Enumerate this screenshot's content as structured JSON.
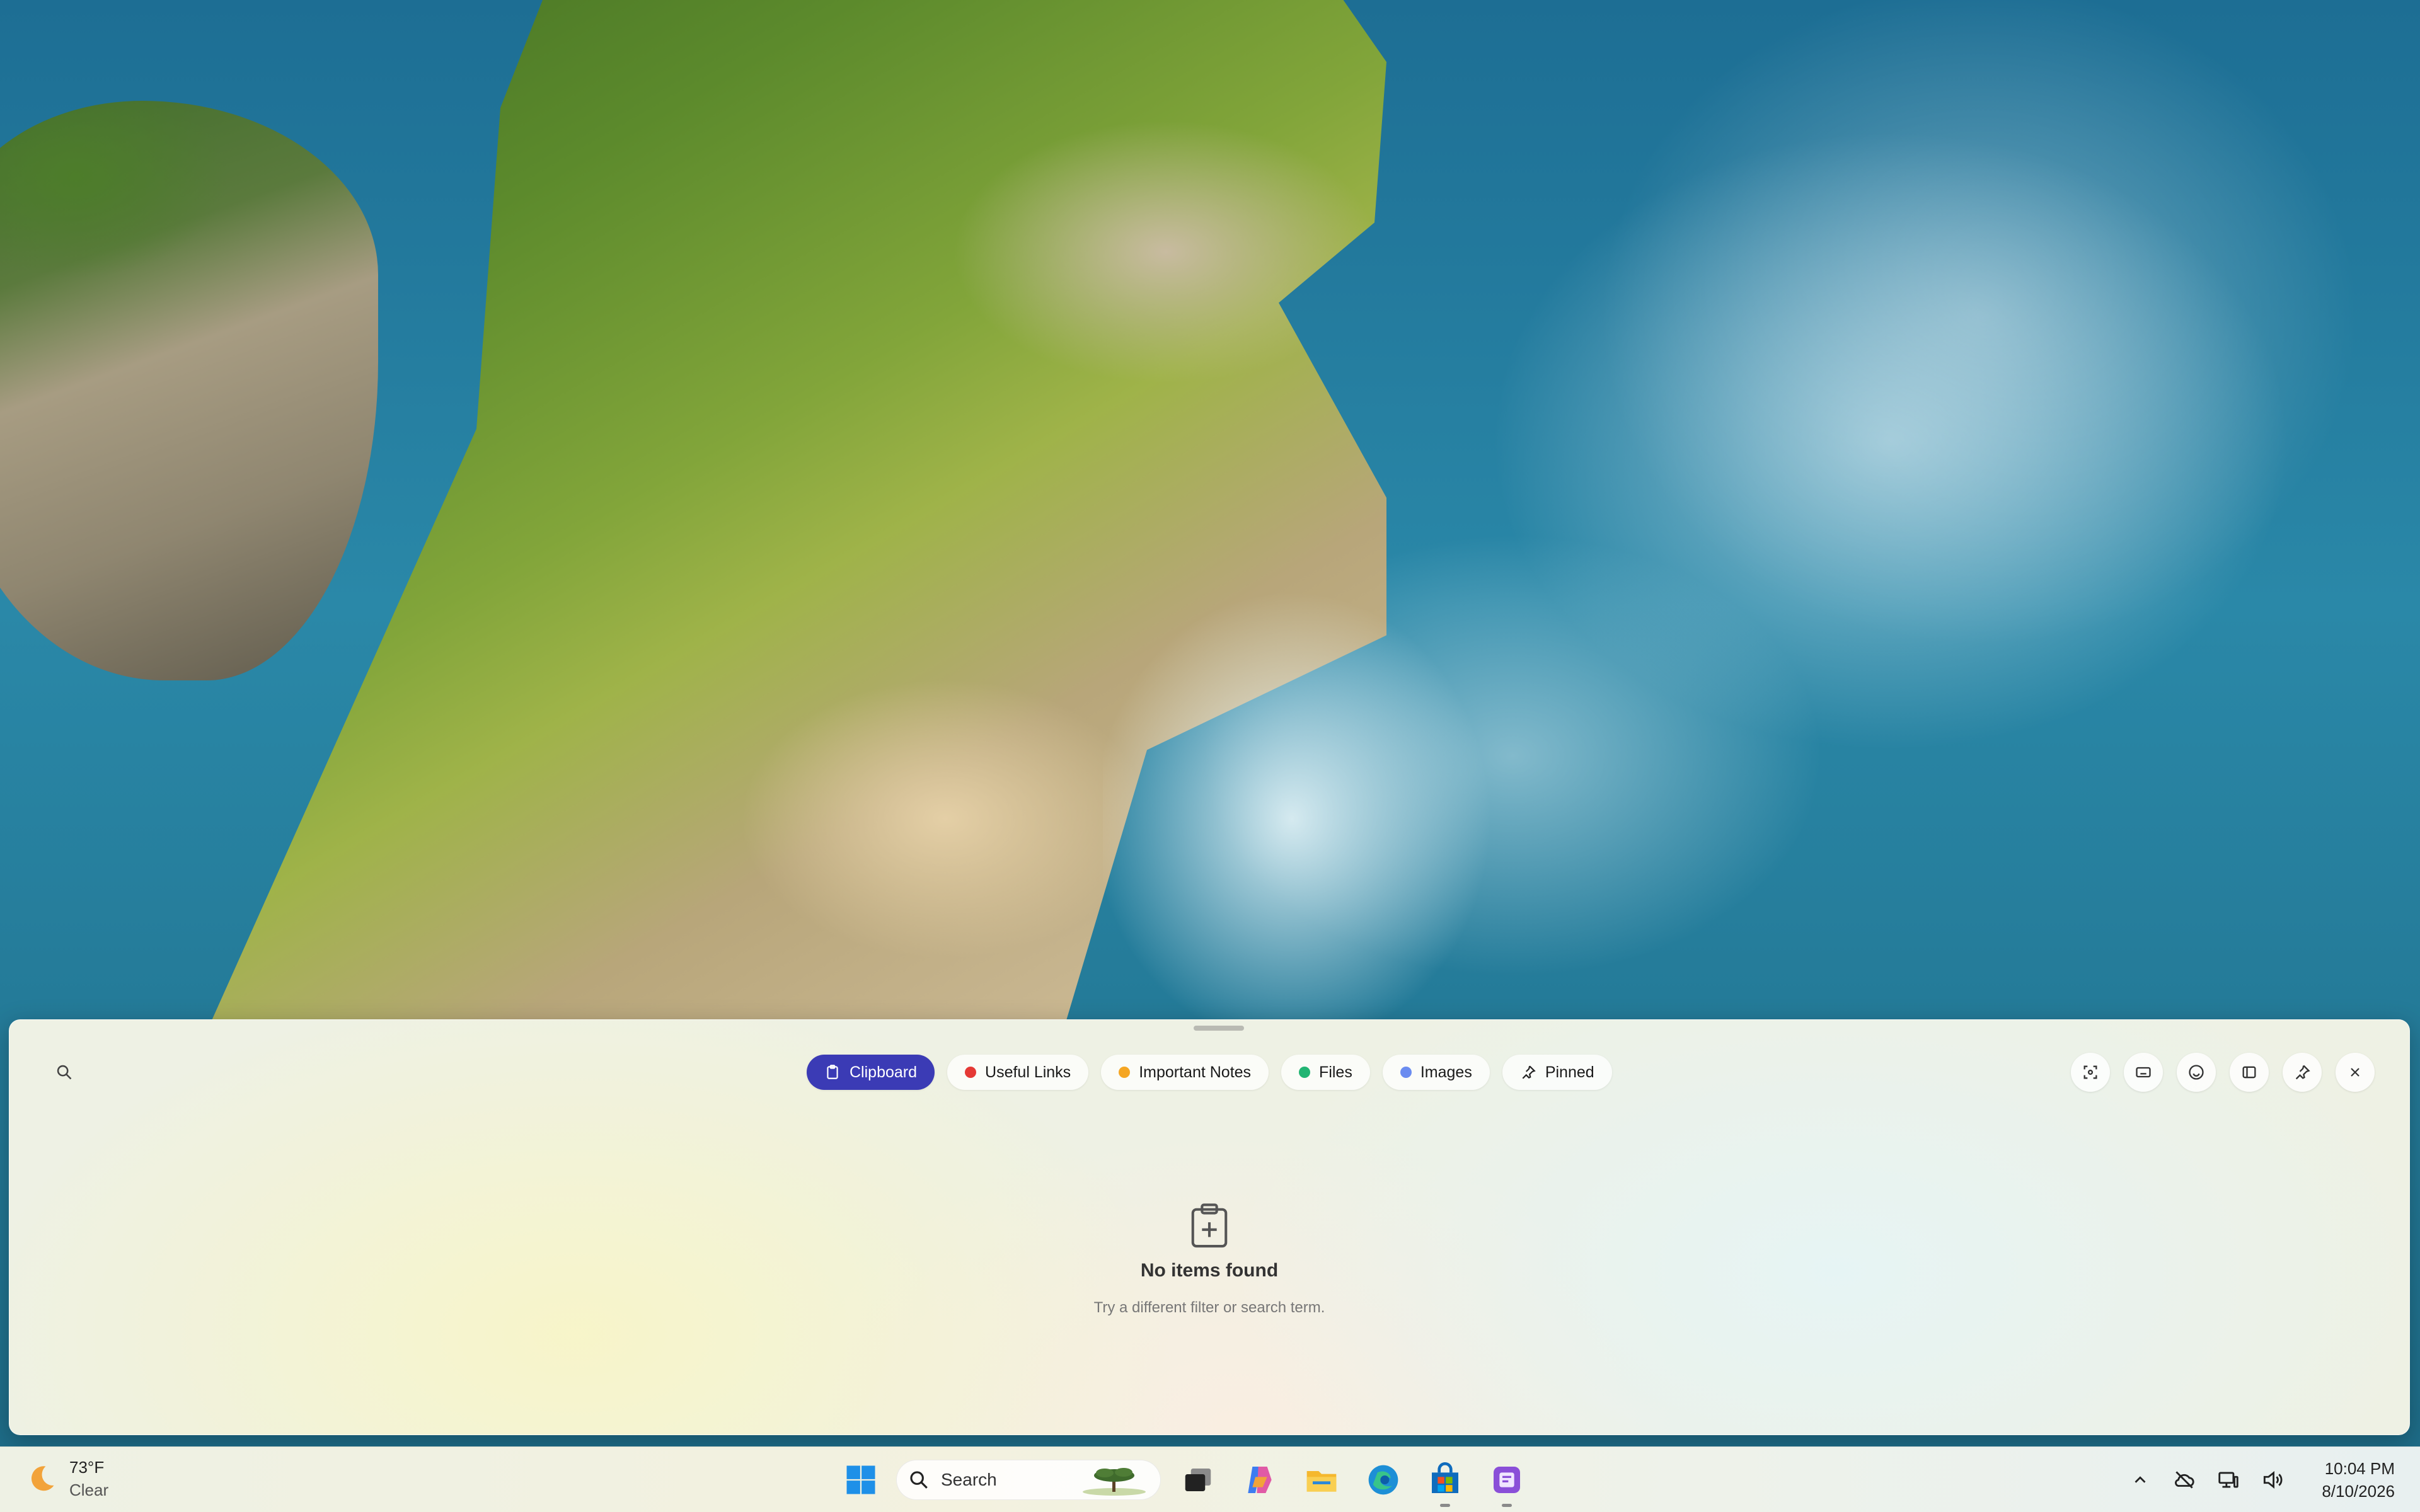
{
  "panel": {
    "tabs": [
      {
        "label": "Clipboard",
        "active": true,
        "icon": "clipboard-icon"
      },
      {
        "label": "Useful Links",
        "dot_color": "#e53935"
      },
      {
        "label": "Important Notes",
        "dot_color": "#f5a623"
      },
      {
        "label": "Files",
        "dot_color": "#22b573"
      },
      {
        "label": "Images",
        "dot_color": "#6b8cf0"
      },
      {
        "label": "Pinned",
        "icon": "pin-icon"
      }
    ],
    "actions": [
      "screenshot-icon",
      "keyboard-icon",
      "emoji-icon",
      "sidebar-icon",
      "pin-icon",
      "close-icon"
    ],
    "empty_state": {
      "title": "No items found",
      "subtitle": "Try a different filter or search term."
    },
    "accent_color": "#3b3bb5"
  },
  "taskbar": {
    "weather": {
      "temperature": "73°F",
      "condition": "Clear"
    },
    "search_placeholder": "Search",
    "apps": [
      "task-view-icon",
      "copilot-icon",
      "file-explorer-icon",
      "edge-icon",
      "store-icon",
      "notes-app-icon"
    ],
    "clock": {
      "time": "10:04 PM",
      "date": "8/10/2026"
    }
  }
}
